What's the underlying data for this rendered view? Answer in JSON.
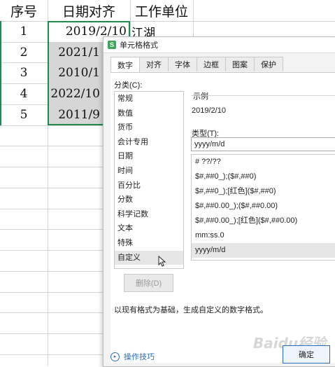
{
  "sheet": {
    "headers": [
      "序号",
      "日期对齐",
      "工作单位"
    ],
    "rows": [
      {
        "num": "1",
        "date": "2019/2/10",
        "unit": "江湖"
      },
      {
        "num": "2",
        "date": "2021/1",
        "unit": ""
      },
      {
        "num": "3",
        "date": "2010/1",
        "unit": ""
      },
      {
        "num": "4",
        "date": "2022/10",
        "unit": ""
      },
      {
        "num": "5",
        "date": "2011/9",
        "unit": ""
      }
    ]
  },
  "dialog": {
    "app_icon": "S",
    "title": "单元格格式",
    "tabs": [
      "数字",
      "对齐",
      "字体",
      "边框",
      "图案",
      "保护"
    ],
    "active_tab": "数字",
    "category_label": "分类(C):",
    "categories": [
      "常规",
      "数值",
      "货币",
      "会计专用",
      "日期",
      "时间",
      "百分比",
      "分数",
      "科学记数",
      "文本",
      "特殊",
      "自定义"
    ],
    "selected_category": "自定义",
    "sample_label": "示例",
    "sample_value": "2019/2/10",
    "type_label": "类型(T):",
    "type_value": "yyyy/m/d",
    "formats": [
      "# ??/??",
      "$#,##0_);($#,##0)",
      "$#,##0_);[红色]($#,##0)",
      "$#,##0.00_);($#,##0.00)",
      "$#,##0.00_);[红色]($#,##0.00)",
      "mm:ss.0",
      "yyyy/m/d"
    ],
    "selected_format": "yyyy/m/d",
    "delete_label": "删除(D)",
    "note": "以现有格式为基础，生成自定义的数字格式。",
    "tip_label": "操作技巧",
    "ok_label": "确定"
  },
  "watermark": "Baidu经验",
  "icons": {
    "app": "wps-spreadsheet-icon",
    "tip": "help-circle-icon",
    "cursor": "mouse-pointer-icon"
  },
  "colors": {
    "selection": "#1f8a4c",
    "accent": "#2a6ebb",
    "shaded_cell": "#d6d6d6"
  }
}
